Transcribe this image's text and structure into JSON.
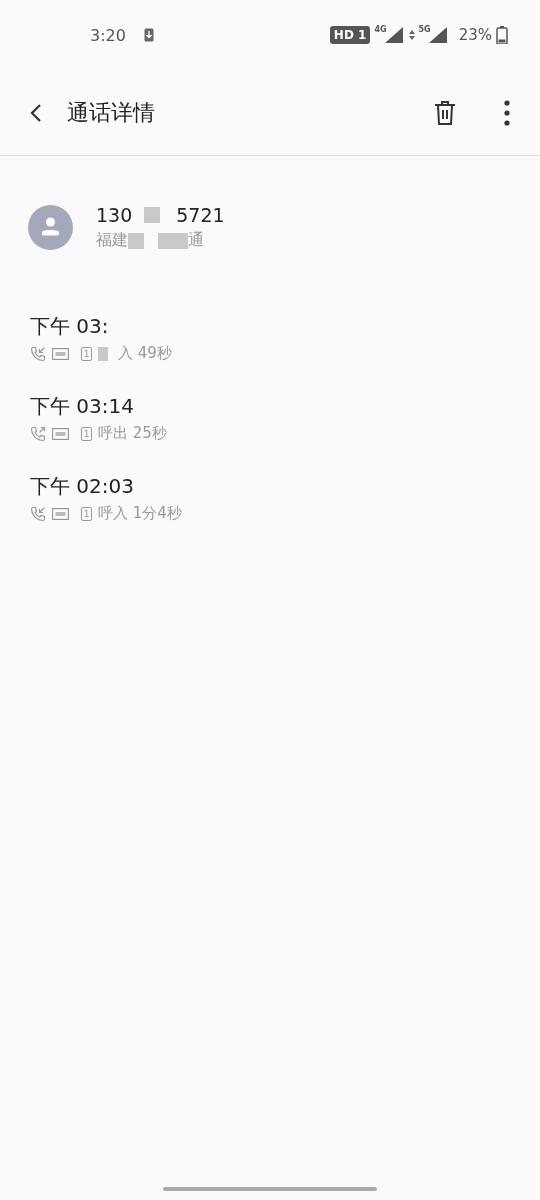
{
  "status_bar": {
    "time": "3:20",
    "hd_badge": "HD 1",
    "network_1": "4G",
    "network_2": "5G",
    "battery": "23%"
  },
  "header": {
    "title": "通话详情"
  },
  "contact": {
    "number_start": "130",
    "number_end": "5721",
    "location_start": "福建",
    "location_end": "通"
  },
  "calls": [
    {
      "time": "下午 03:",
      "kind": "incoming",
      "sim": "1",
      "detail": "入 49秒",
      "redacted": true
    },
    {
      "time": "下午 03:14",
      "kind": "outgoing",
      "sim": "1",
      "detail": "呼出 25秒",
      "redacted": false
    },
    {
      "time": "下午 02:03",
      "kind": "incoming",
      "sim": "1",
      "detail": "呼入 1分4秒",
      "redacted": false
    }
  ]
}
